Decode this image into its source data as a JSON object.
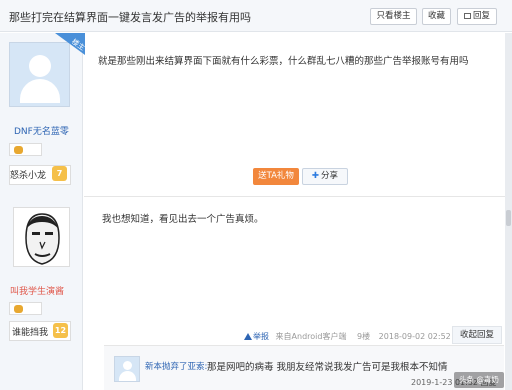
{
  "header": {
    "title": "那些打完在结算界面一键发言发广告的举报有用吗",
    "buttons": {
      "only_lz": "只看楼主",
      "favorite": "收藏",
      "reply": "回复"
    }
  },
  "post1": {
    "louzhu_badge": "楼主",
    "author": "DNF无名蓝零",
    "level_name": "怒杀小龙",
    "level_num": "7",
    "content": "就是那些刚出来结算界面下面就有什么彩票，什么群乱七八糟的那些广告举报账号有用吗",
    "gift_button": "送TA礼物",
    "share_button": "分享"
  },
  "post2": {
    "author": "叫我学生演酱",
    "level_name": "谁能挡我",
    "level_num": "12",
    "content": "我也想知道，看见出去一个广告真烦。",
    "report": "举报",
    "client": "来自Android客户端",
    "floor": "9楼",
    "time": "2018-09-02 02:52",
    "collapse_button": "收起回复"
  },
  "subreply": {
    "author": "新本抛弃了亚索:",
    "text": "那是网吧的病毒 我朋友经常说我发广告可是我根本不知情",
    "time": "2019-1-23 01:32 回复"
  },
  "watermark": "头条 @毒奶"
}
